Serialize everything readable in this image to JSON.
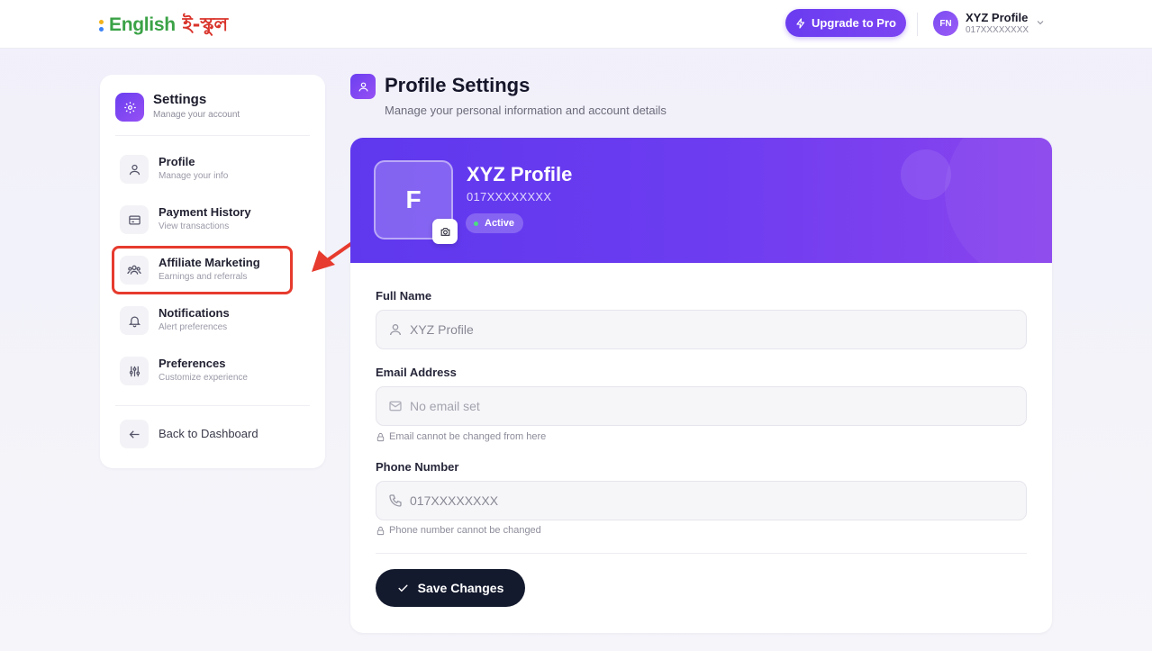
{
  "header": {
    "logo_en": "English",
    "logo_bn": "ই-স্কুল",
    "upgrade_label": "Upgrade to Pro",
    "user_initials": "FN",
    "user_name": "XYZ Profile",
    "user_phone": "017XXXXXXXX"
  },
  "sidebar": {
    "title": "Settings",
    "subtitle": "Manage your account",
    "items": [
      {
        "label": "Profile",
        "sub": "Manage your info",
        "icon": "user-icon"
      },
      {
        "label": "Payment History",
        "sub": "View transactions",
        "icon": "credit-card-icon"
      },
      {
        "label": "Affiliate Marketing",
        "sub": "Earnings and referrals",
        "icon": "users-icon"
      },
      {
        "label": "Notifications",
        "sub": "Alert preferences",
        "icon": "bell-icon"
      },
      {
        "label": "Preferences",
        "sub": "Customize experience",
        "icon": "sliders-icon"
      }
    ],
    "back_label": "Back to Dashboard"
  },
  "main": {
    "title": "Profile Settings",
    "subtitle": "Manage your personal information and account details"
  },
  "profile": {
    "avatar_letter": "F",
    "name": "XYZ Profile",
    "phone": "017XXXXXXXX",
    "status": "Active"
  },
  "form": {
    "full_name_label": "Full Name",
    "full_name_value": "XYZ Profile",
    "email_label": "Email Address",
    "email_placeholder": "No email set",
    "email_note": "Email cannot be changed from here",
    "phone_label": "Phone Number",
    "phone_value": "017XXXXXXXX",
    "phone_note": "Phone number cannot be changed",
    "save_label": "Save Changes"
  },
  "colors": {
    "brand_purple": "#6b3ff0",
    "highlight_red": "#e63b2e",
    "logo_green": "#3aa246",
    "save_dark": "#141a2e"
  }
}
